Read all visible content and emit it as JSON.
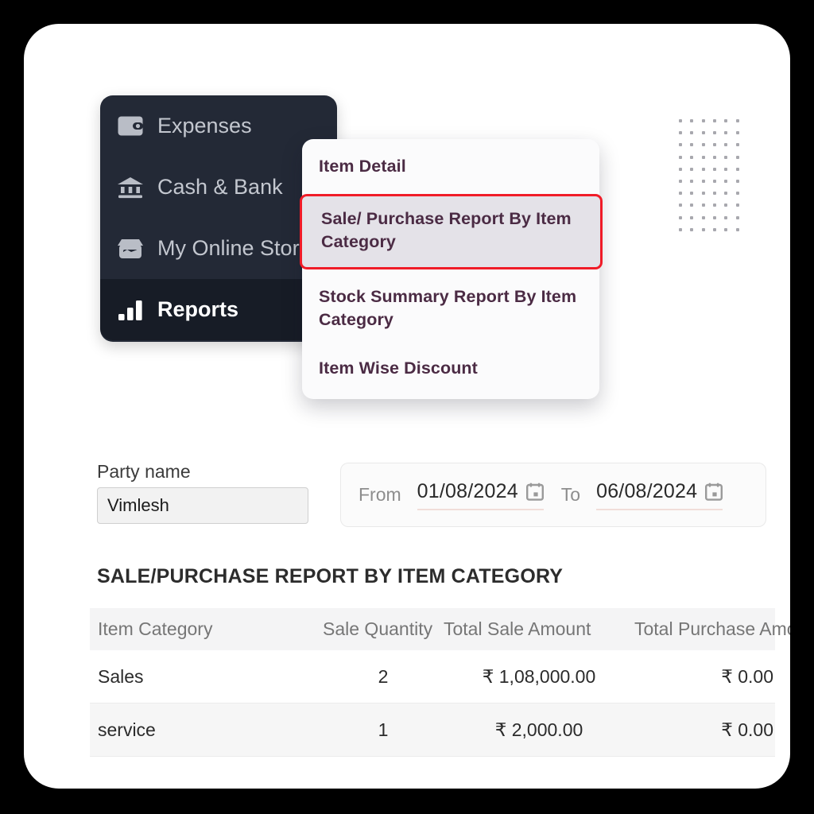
{
  "sidebar": {
    "items": [
      {
        "label": "Expenses",
        "icon": "wallet-icon",
        "active": false
      },
      {
        "label": "Cash & Bank",
        "icon": "bank-icon",
        "active": false
      },
      {
        "label": "My Online Store",
        "icon": "storefront-icon",
        "active": false
      },
      {
        "label": "Reports",
        "icon": "bar-chart-icon",
        "active": true
      }
    ]
  },
  "menu": {
    "items": [
      {
        "label": "Item Detail",
        "selected": false
      },
      {
        "label": "Sale/ Purchase Report By Item Category",
        "selected": true
      },
      {
        "label": "Stock Summary Report By Item Category",
        "selected": false
      },
      {
        "label": "Item Wise Discount",
        "selected": false
      }
    ],
    "highlight_color": "#f01c28"
  },
  "filters": {
    "party_label": "Party name",
    "party_value": "Vimlesh",
    "party_placeholder": "Party name",
    "from_label": "From",
    "from_value": "01/08/2024",
    "to_label": "To",
    "to_value": "06/08/2024"
  },
  "report": {
    "title": "SALE/PURCHASE REPORT BY ITEM CATEGORY",
    "columns": [
      "Item Category",
      "Sale Quantity",
      "Total Sale Amount",
      "Total Purchase Amount"
    ],
    "rows": [
      {
        "category": "Sales",
        "quantity": "2",
        "sale_amount": "₹ 1,08,000.00",
        "purchase_amount": "₹ 0.00"
      },
      {
        "category": "service",
        "quantity": "1",
        "sale_amount": "₹ 2,000.00",
        "purchase_amount": "₹ 0.00"
      }
    ]
  },
  "theme": {
    "page_background": "#000000",
    "card_background": "#ffffff",
    "sidebar_background": "#232936",
    "sidebar_active_background": "#171c26",
    "menu_text_color": "#4b2b44",
    "menu_selected_background": "#e4e2e8",
    "table_header_background": "#f4f4f5"
  }
}
